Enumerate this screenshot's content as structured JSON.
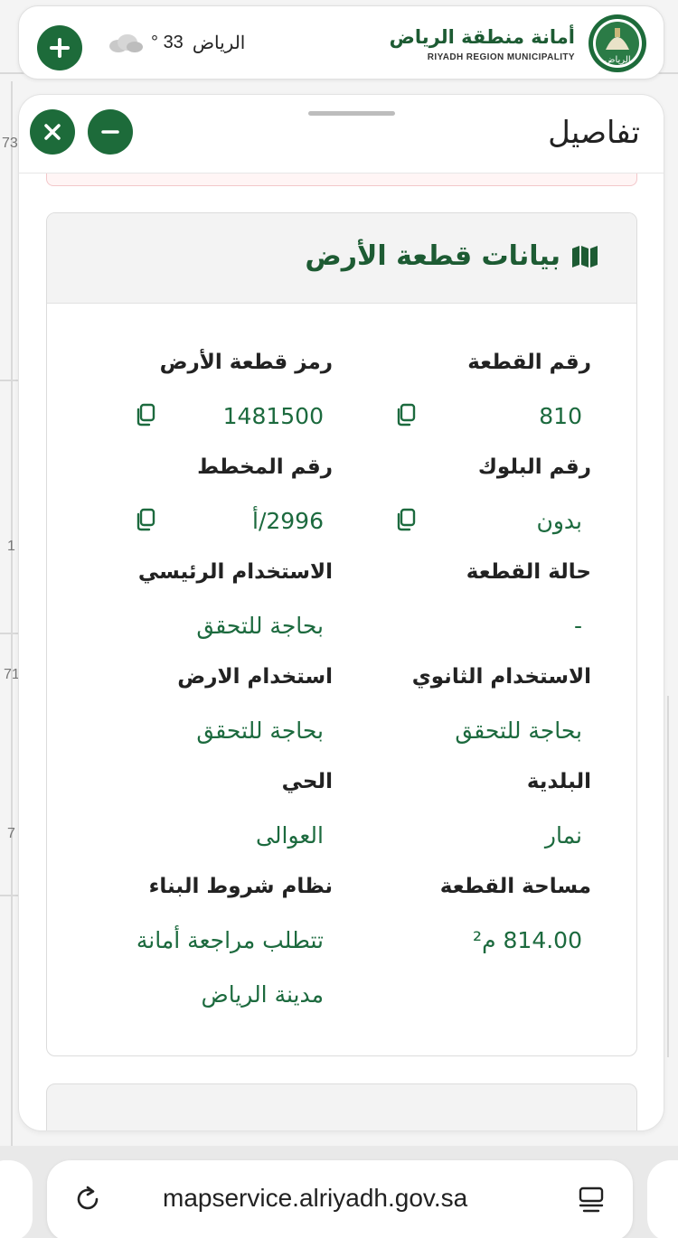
{
  "header": {
    "logo_ar": "أمانة منطقة الرياض",
    "logo_en": "RIYADH REGION MUNICIPALITY",
    "logo_emblem_text": "الرياض",
    "weather": {
      "city": "الرياض",
      "temp": "33 °"
    }
  },
  "map": {
    "edge_labels": [
      "73",
      "1",
      "71",
      "7"
    ]
  },
  "panel": {
    "title": "تفاصيل"
  },
  "land": {
    "title": "بيانات قطعة الأرض",
    "fields": [
      {
        "label": "رقم القطعة",
        "value": "810"
      },
      {
        "label": "رمز قطعة الأرض",
        "value": "1481500"
      },
      {
        "label": "رقم البلوك",
        "value": "بدون"
      },
      {
        "label": "رقم المخطط",
        "value": "2996/أ"
      },
      {
        "label": "حالة القطعة",
        "value": "-"
      },
      {
        "label": "الاستخدام الرئيسي",
        "value": "بحاجة للتحقق"
      },
      {
        "label": "الاستخدام الثانوي",
        "value": "بحاجة للتحقق"
      },
      {
        "label": "استخدام الارض",
        "value": "بحاجة للتحقق"
      },
      {
        "label": "البلدية",
        "value": "نمار"
      },
      {
        "label": "الحي",
        "value": "العوالى"
      },
      {
        "label": "مساحة القطعة",
        "value": "814.00 م²"
      },
      {
        "label": "نظام شروط البناء",
        "value_line1": "تتطلب مراجعة أمانة",
        "value_line2": "مدينة الرياض"
      }
    ]
  },
  "browser": {
    "url": "mapservice.alriyadh.gov.sa"
  },
  "colors": {
    "brand_green": "#1d6b3a",
    "value_green": "#1c6a3e",
    "title_green": "#1d5b33"
  }
}
